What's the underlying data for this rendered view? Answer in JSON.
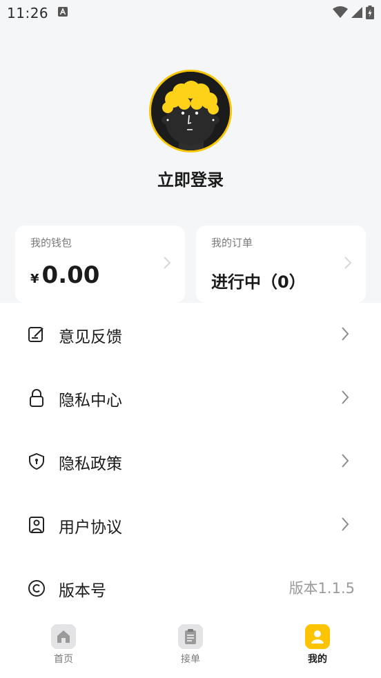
{
  "status_bar": {
    "time": "11:26"
  },
  "profile": {
    "login_text": "立即登录"
  },
  "wallet_card": {
    "title": "我的钱包",
    "currency": "¥",
    "amount": "0.00"
  },
  "order_card": {
    "title": "我的订单",
    "status": "进行中（0）"
  },
  "menu": {
    "items": [
      {
        "label": "意见反馈",
        "icon": "feedback-edit-icon"
      },
      {
        "label": "隐私中心",
        "icon": "lock-icon"
      },
      {
        "label": "隐私政策",
        "icon": "shield-icon"
      },
      {
        "label": "用户协议",
        "icon": "user-agreement-icon"
      },
      {
        "label": "版本号",
        "icon": "copyright-icon",
        "value": "版本1.1.5"
      }
    ]
  },
  "tabbar": {
    "tabs": [
      {
        "label": "首页",
        "icon": "home-icon",
        "active": false
      },
      {
        "label": "接单",
        "icon": "clipboard-icon",
        "active": false
      },
      {
        "label": "我的",
        "icon": "person-icon",
        "active": true
      }
    ]
  },
  "colors": {
    "accent": "#ffc400",
    "background": "#f5f6f8",
    "avatar_border": "#f7c600"
  }
}
